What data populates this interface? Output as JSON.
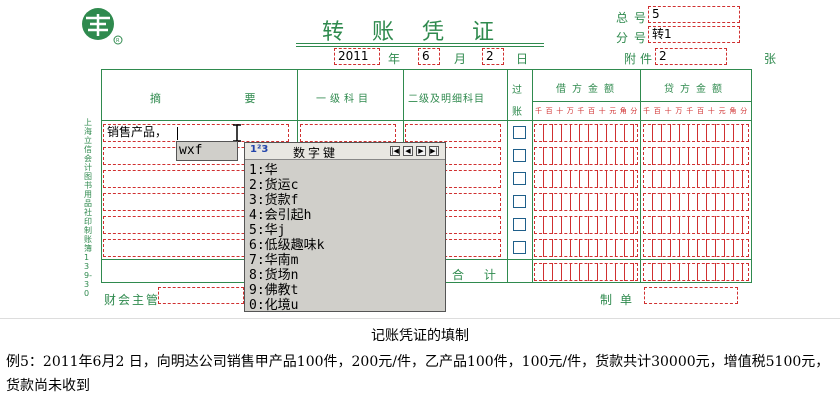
{
  "voucher": {
    "title": "转账凭证",
    "total_no_label": "总号",
    "total_no_value": "5",
    "sub_no_label": "分号",
    "sub_no_value": "转1",
    "year": "2011",
    "year_label": "年",
    "month": "6",
    "month_label": "月",
    "day": "2",
    "day_label": "日",
    "attach_label": "附件",
    "attach_value": "2",
    "attach_unit": "张",
    "headers": {
      "summary": "摘 要",
      "level1": "一级科目",
      "level2": "二级及明细科目",
      "posted": "过账",
      "debit": "借方金额",
      "credit": "贷方金额"
    },
    "digit_labels": [
      "千",
      "百",
      "十",
      "万",
      "千",
      "百",
      "十",
      "元",
      "角",
      "分"
    ],
    "rows": [
      {
        "summary": "销售产品，"
      },
      {
        "summary": ""
      },
      {
        "summary": ""
      },
      {
        "summary": ""
      },
      {
        "summary": ""
      },
      {
        "summary": ""
      }
    ],
    "total_label": "合 计",
    "supervisor_label": "财会主管",
    "maker_label": "制单",
    "side_text": "上海立信会计图书用品社印制 账簿139-30"
  },
  "ime": {
    "composition": "wxf",
    "title": "数字键",
    "logo": "1²3",
    "nav": [
      "|◀",
      "◀",
      "▶",
      "▶|"
    ],
    "candidates": [
      "1:华",
      "2:货运c",
      "3:货款f",
      "4:会引起h",
      "5:华j",
      "6:低级趣味k",
      "7:华南m",
      "8:货场n",
      "9:佛教t",
      "0:化境u"
    ]
  },
  "caption": {
    "title": "记账凭证的填制",
    "body": "例5：2011年6月2 日，向明达公司销售甲产品100件，200元/件，乙产品100件，100元/件，货款共计30000元，增值税5100元，货款尚未收到"
  },
  "colors": {
    "form_green": "#2f8a4e",
    "field_red": "#d03030",
    "caption_bg": "#ffffff"
  }
}
